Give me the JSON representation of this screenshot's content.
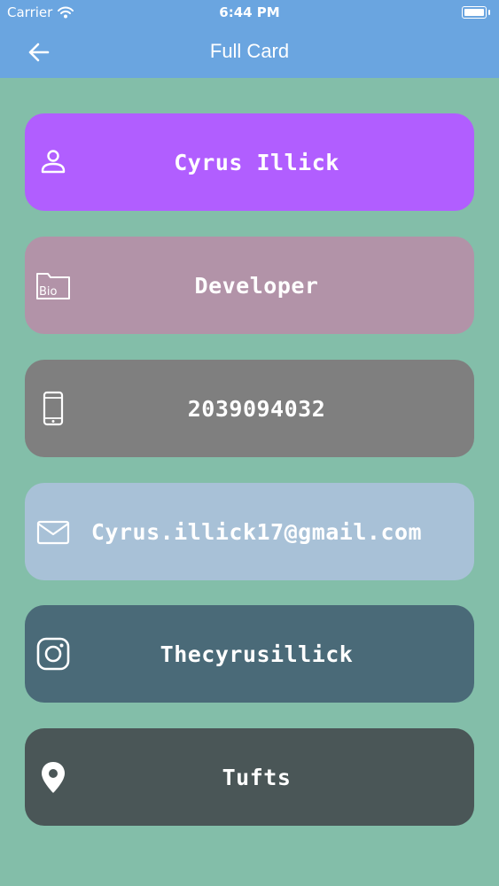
{
  "status_bar": {
    "carrier": "Carrier",
    "time": "6:44 PM"
  },
  "app_bar": {
    "title": "Full Card"
  },
  "cards": [
    {
      "icon": "person-icon",
      "text": "Cyrus Illick",
      "color": "#b15eff"
    },
    {
      "icon": "bio-folder-icon",
      "text": "Developer",
      "color": "#b293a8"
    },
    {
      "icon": "phone-icon",
      "text": "2039094032",
      "color": "#7f7f7f"
    },
    {
      "icon": "mail-icon",
      "text": "Cyrus.illick17@gmail.com",
      "color": "#a8c1d7"
    },
    {
      "icon": "instagram-icon",
      "text": "Thecyrusillick",
      "color": "#4a6a78"
    },
    {
      "icon": "location-pin-icon",
      "text": "Tufts",
      "color": "#4a5657"
    }
  ]
}
